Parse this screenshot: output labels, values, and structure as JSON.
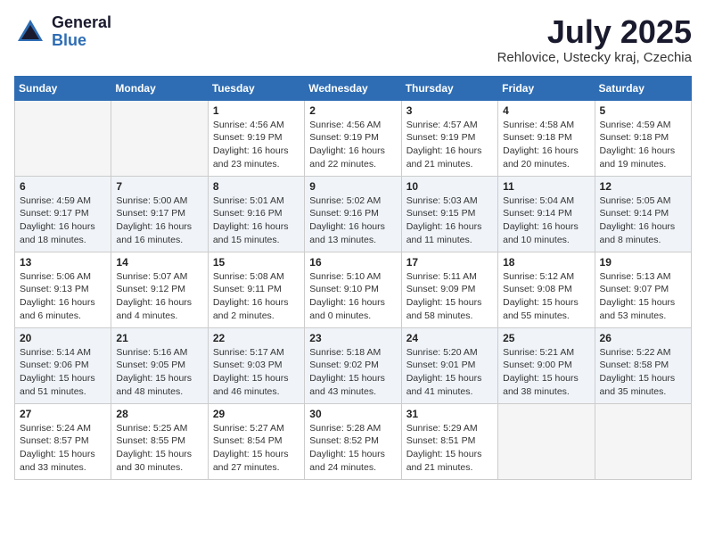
{
  "logo": {
    "general": "General",
    "blue": "Blue"
  },
  "title": "July 2025",
  "location": "Rehlovice, Ustecky kraj, Czechia",
  "weekdays": [
    "Sunday",
    "Monday",
    "Tuesday",
    "Wednesday",
    "Thursday",
    "Friday",
    "Saturday"
  ],
  "weeks": [
    [
      {
        "day": "",
        "info": ""
      },
      {
        "day": "",
        "info": ""
      },
      {
        "day": "1",
        "info": "Sunrise: 4:56 AM\nSunset: 9:19 PM\nDaylight: 16 hours\nand 23 minutes."
      },
      {
        "day": "2",
        "info": "Sunrise: 4:56 AM\nSunset: 9:19 PM\nDaylight: 16 hours\nand 22 minutes."
      },
      {
        "day": "3",
        "info": "Sunrise: 4:57 AM\nSunset: 9:19 PM\nDaylight: 16 hours\nand 21 minutes."
      },
      {
        "day": "4",
        "info": "Sunrise: 4:58 AM\nSunset: 9:18 PM\nDaylight: 16 hours\nand 20 minutes."
      },
      {
        "day": "5",
        "info": "Sunrise: 4:59 AM\nSunset: 9:18 PM\nDaylight: 16 hours\nand 19 minutes."
      }
    ],
    [
      {
        "day": "6",
        "info": "Sunrise: 4:59 AM\nSunset: 9:17 PM\nDaylight: 16 hours\nand 18 minutes."
      },
      {
        "day": "7",
        "info": "Sunrise: 5:00 AM\nSunset: 9:17 PM\nDaylight: 16 hours\nand 16 minutes."
      },
      {
        "day": "8",
        "info": "Sunrise: 5:01 AM\nSunset: 9:16 PM\nDaylight: 16 hours\nand 15 minutes."
      },
      {
        "day": "9",
        "info": "Sunrise: 5:02 AM\nSunset: 9:16 PM\nDaylight: 16 hours\nand 13 minutes."
      },
      {
        "day": "10",
        "info": "Sunrise: 5:03 AM\nSunset: 9:15 PM\nDaylight: 16 hours\nand 11 minutes."
      },
      {
        "day": "11",
        "info": "Sunrise: 5:04 AM\nSunset: 9:14 PM\nDaylight: 16 hours\nand 10 minutes."
      },
      {
        "day": "12",
        "info": "Sunrise: 5:05 AM\nSunset: 9:14 PM\nDaylight: 16 hours\nand 8 minutes."
      }
    ],
    [
      {
        "day": "13",
        "info": "Sunrise: 5:06 AM\nSunset: 9:13 PM\nDaylight: 16 hours\nand 6 minutes."
      },
      {
        "day": "14",
        "info": "Sunrise: 5:07 AM\nSunset: 9:12 PM\nDaylight: 16 hours\nand 4 minutes."
      },
      {
        "day": "15",
        "info": "Sunrise: 5:08 AM\nSunset: 9:11 PM\nDaylight: 16 hours\nand 2 minutes."
      },
      {
        "day": "16",
        "info": "Sunrise: 5:10 AM\nSunset: 9:10 PM\nDaylight: 16 hours\nand 0 minutes."
      },
      {
        "day": "17",
        "info": "Sunrise: 5:11 AM\nSunset: 9:09 PM\nDaylight: 15 hours\nand 58 minutes."
      },
      {
        "day": "18",
        "info": "Sunrise: 5:12 AM\nSunset: 9:08 PM\nDaylight: 15 hours\nand 55 minutes."
      },
      {
        "day": "19",
        "info": "Sunrise: 5:13 AM\nSunset: 9:07 PM\nDaylight: 15 hours\nand 53 minutes."
      }
    ],
    [
      {
        "day": "20",
        "info": "Sunrise: 5:14 AM\nSunset: 9:06 PM\nDaylight: 15 hours\nand 51 minutes."
      },
      {
        "day": "21",
        "info": "Sunrise: 5:16 AM\nSunset: 9:05 PM\nDaylight: 15 hours\nand 48 minutes."
      },
      {
        "day": "22",
        "info": "Sunrise: 5:17 AM\nSunset: 9:03 PM\nDaylight: 15 hours\nand 46 minutes."
      },
      {
        "day": "23",
        "info": "Sunrise: 5:18 AM\nSunset: 9:02 PM\nDaylight: 15 hours\nand 43 minutes."
      },
      {
        "day": "24",
        "info": "Sunrise: 5:20 AM\nSunset: 9:01 PM\nDaylight: 15 hours\nand 41 minutes."
      },
      {
        "day": "25",
        "info": "Sunrise: 5:21 AM\nSunset: 9:00 PM\nDaylight: 15 hours\nand 38 minutes."
      },
      {
        "day": "26",
        "info": "Sunrise: 5:22 AM\nSunset: 8:58 PM\nDaylight: 15 hours\nand 35 minutes."
      }
    ],
    [
      {
        "day": "27",
        "info": "Sunrise: 5:24 AM\nSunset: 8:57 PM\nDaylight: 15 hours\nand 33 minutes."
      },
      {
        "day": "28",
        "info": "Sunrise: 5:25 AM\nSunset: 8:55 PM\nDaylight: 15 hours\nand 30 minutes."
      },
      {
        "day": "29",
        "info": "Sunrise: 5:27 AM\nSunset: 8:54 PM\nDaylight: 15 hours\nand 27 minutes."
      },
      {
        "day": "30",
        "info": "Sunrise: 5:28 AM\nSunset: 8:52 PM\nDaylight: 15 hours\nand 24 minutes."
      },
      {
        "day": "31",
        "info": "Sunrise: 5:29 AM\nSunset: 8:51 PM\nDaylight: 15 hours\nand 21 minutes."
      },
      {
        "day": "",
        "info": ""
      },
      {
        "day": "",
        "info": ""
      }
    ]
  ]
}
